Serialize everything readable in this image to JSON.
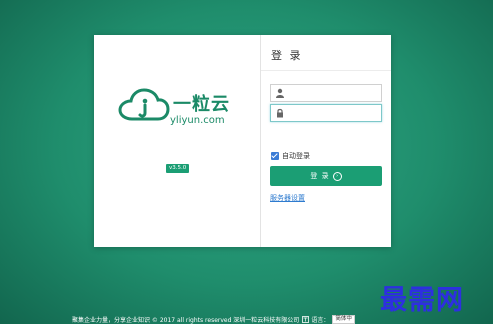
{
  "colors": {
    "background": "#1f8d6c",
    "brand": "#1b8a67",
    "button": "#1b9e74",
    "link": "#2e7bcf",
    "watermark": "#2d2fe0"
  },
  "brand": {
    "logo_icon": "cloud-info-icon",
    "name_cn": "一粒云",
    "name_en": "yliyun.com",
    "version": "v3.5.0"
  },
  "form": {
    "title": "登 录",
    "username": {
      "icon": "user-icon",
      "value": "",
      "placeholder": ""
    },
    "password": {
      "icon": "lock-icon",
      "value": "",
      "placeholder": ""
    },
    "remember_label": "自动登录",
    "remember_checked": true,
    "login_label": "登 录",
    "login_icon": "arrow-circle-right-icon",
    "server_settings_label": "服务器设置"
  },
  "footer": {
    "text": "聚集企业力量，分享企业知识 © 2017 all rights reserved 深圳一粒云科技有限公司",
    "language_icon": "language-icon",
    "language_label": "语言：",
    "language_value": "简体中"
  },
  "watermark": "最需网"
}
